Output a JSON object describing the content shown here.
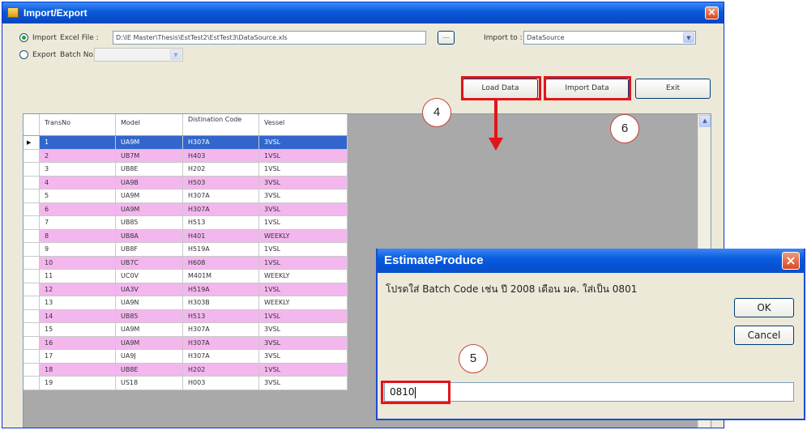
{
  "window": {
    "title": "Import/Export",
    "close_glyph": "×"
  },
  "form": {
    "import_radio_label": "Import",
    "excel_file_label": "Excel File :",
    "excel_file_path": "D:\\IE Master\\Thesis\\EstTest2\\EstTest3\\DataSource.xls",
    "browse_label": "...",
    "export_radio_label": "Export",
    "batch_no_label": "Batch No.",
    "import_to_label": "Import to :",
    "import_to_value": "DataSource",
    "load_data_label": "Load Data",
    "import_data_label": "Import Data",
    "exit_label": "Exit"
  },
  "grid": {
    "columns": [
      "TransNo",
      "Model",
      "Distination Code",
      "Vessel"
    ],
    "rows": [
      [
        "1",
        "UA9M",
        "H307A",
        "3VSL"
      ],
      [
        "2",
        "UB7M",
        "H403",
        "1VSL"
      ],
      [
        "3",
        "UB8E",
        "H202",
        "1VSL"
      ],
      [
        "4",
        "UA9B",
        "H503",
        "3VSL"
      ],
      [
        "5",
        "UA9M",
        "H307A",
        "3VSL"
      ],
      [
        "6",
        "UA9M",
        "H307A",
        "3VSL"
      ],
      [
        "7",
        "UB85",
        "H513",
        "1VSL"
      ],
      [
        "8",
        "UB8A",
        "H401",
        "WEEKLY"
      ],
      [
        "9",
        "UB8F",
        "H519A",
        "1VSL"
      ],
      [
        "10",
        "UB7C",
        "H608",
        "1VSL"
      ],
      [
        "11",
        "UC0V",
        "M401M",
        "WEEKLY"
      ],
      [
        "12",
        "UA3V",
        "H519A",
        "1VSL"
      ],
      [
        "13",
        "UA9N",
        "H303B",
        "WEEKLY"
      ],
      [
        "14",
        "UB85",
        "H513",
        "1VSL"
      ],
      [
        "15",
        "UA9M",
        "H307A",
        "3VSL"
      ],
      [
        "16",
        "UA9M",
        "H307A",
        "3VSL"
      ],
      [
        "17",
        "UA9J",
        "H307A",
        "3VSL"
      ],
      [
        "18",
        "UB8E",
        "H202",
        "1VSL"
      ],
      [
        "19",
        "US18",
        "H003",
        "3VSL"
      ]
    ],
    "selected_row": "1",
    "row_pointer_glyph": "▶",
    "scroll_up_glyph": "▲"
  },
  "annotations": {
    "step_load": "4",
    "step_batch": "5",
    "step_import": "6",
    "arrow_color": "#e3141a"
  },
  "dialog": {
    "title": "EstimateProduce",
    "prompt": "โปรดใส่ Batch Code เช่น ปี 2008 เดือน มค. ใส่เป็น 0801",
    "ok_label": "OK",
    "cancel_label": "Cancel",
    "input_value": "0810",
    "close_glyph": "×"
  },
  "colors": {
    "titlebar_blue": "#0a58d8",
    "row_pink": "#f3b7ee",
    "row_selected": "#3266cc",
    "highlight_red": "#e3141a"
  }
}
